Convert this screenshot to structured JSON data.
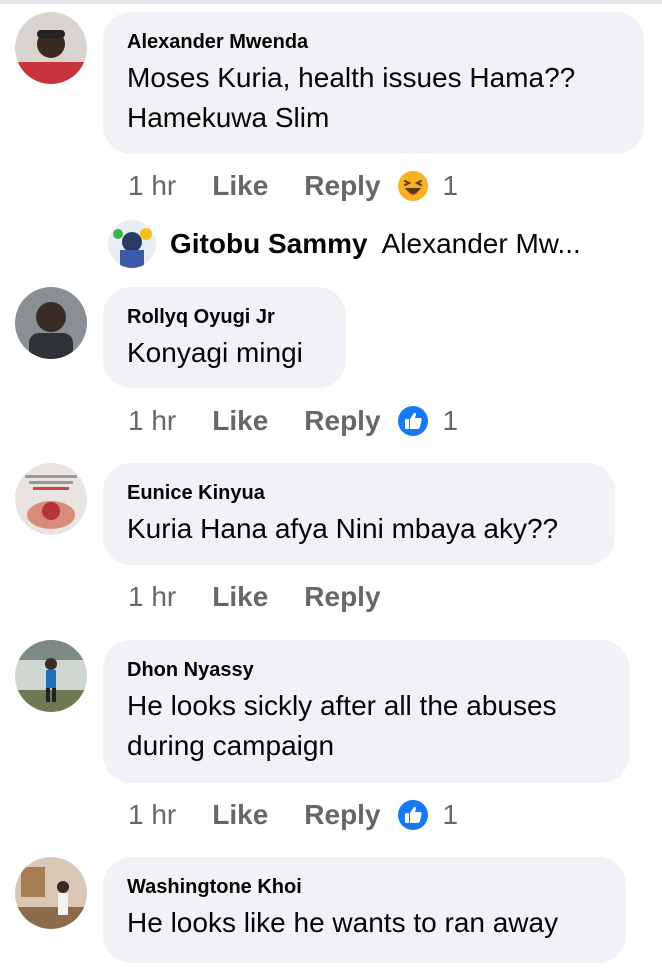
{
  "comments": [
    {
      "author": "Alexander Mwenda",
      "text": "Moses Kuria, health issues Hama?? Hamekuwa Slim",
      "time": "1 hr",
      "like_label": "Like",
      "reply_label": "Reply",
      "reaction_icon": "haha-emoji-icon",
      "reaction_count": "1",
      "reply_preview": {
        "author": "Gitobu Sammy",
        "text": "Alexander Mw..."
      }
    },
    {
      "author": "Rollyq Oyugi Jr",
      "text": "Konyagi mingi",
      "time": "1 hr",
      "like_label": "Like",
      "reply_label": "Reply",
      "reaction_icon": "like-thumb-icon",
      "reaction_count": "1"
    },
    {
      "author": "Eunice Kinyua",
      "text": "Kuria Hana afya Nini mbaya aky??",
      "time": "1 hr",
      "like_label": "Like",
      "reply_label": "Reply"
    },
    {
      "author": "Dhon Nyassy",
      "text": "He looks sickly after all the abuses during campaign",
      "time": "1 hr",
      "like_label": "Like",
      "reply_label": "Reply",
      "reaction_icon": "like-thumb-icon",
      "reaction_count": "1"
    },
    {
      "author": "Washingtone Khoi",
      "text": "He looks like he wants to ran away"
    }
  ],
  "colors": {
    "bubble": "#f0f2f5",
    "meta_text": "#65676b",
    "like_blue": "#1877f2",
    "haha_yellow": "#f7b125"
  }
}
